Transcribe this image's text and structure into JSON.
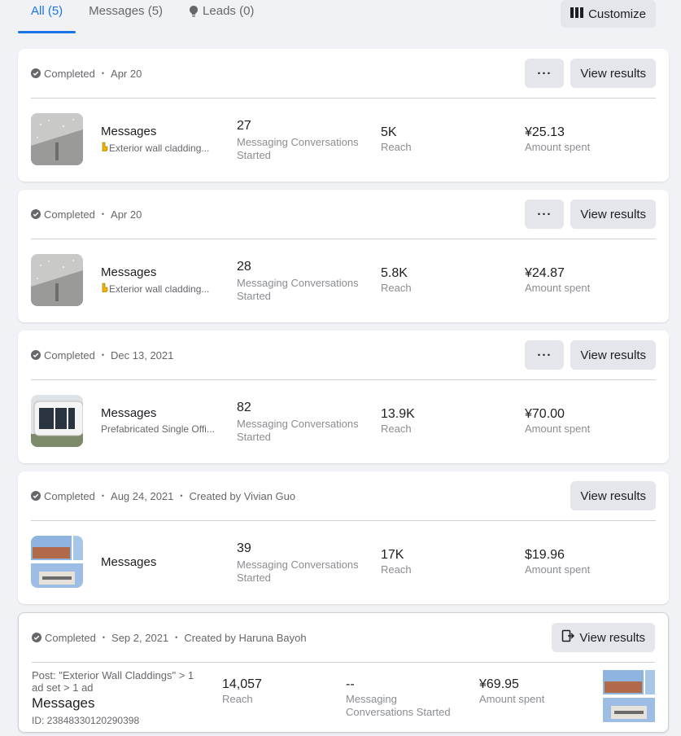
{
  "tabs": [
    {
      "label": "All (5)",
      "active": true
    },
    {
      "label": "Messages (5)",
      "active": false
    },
    {
      "label": "Leads (0)",
      "active": false
    }
  ],
  "customize_label": "Customize",
  "more_label": "···",
  "view_results_label": "View results",
  "cards": [
    {
      "status": "Completed",
      "date": "Apr 20",
      "ad_name": "Messages",
      "ad_sub": "Exterior wall cladding...",
      "m1_val": "27",
      "m1_lbl": "Messaging Conversations Started",
      "m2_val": "5K",
      "m2_lbl": "Reach",
      "m3_val": "¥25.13",
      "m3_lbl": "Amount spent"
    },
    {
      "status": "Completed",
      "date": "Apr 20",
      "ad_name": "Messages",
      "ad_sub": "Exterior wall cladding...",
      "m1_val": "28",
      "m1_lbl": "Messaging Conversations Started",
      "m2_val": "5.8K",
      "m2_lbl": "Reach",
      "m3_val": "¥24.87",
      "m3_lbl": "Amount spent"
    },
    {
      "status": "Completed",
      "date": "Dec 13, 2021",
      "ad_name": "Messages",
      "ad_sub": "Prefabricated Single Offi...",
      "m1_val": "82",
      "m1_lbl": "Messaging Conversations Started",
      "m2_val": "13.9K",
      "m2_lbl": "Reach",
      "m3_val": "¥70.00",
      "m3_lbl": "Amount spent"
    },
    {
      "status": "Completed",
      "date": "Aug 24, 2021",
      "created_by": "Created by Vivian Guo",
      "ad_name": "Messages",
      "m1_val": "39",
      "m1_lbl": "Messaging Conversations Started",
      "m2_val": "17K",
      "m2_lbl": "Reach",
      "m3_val": "$19.96",
      "m3_lbl": "Amount spent"
    }
  ],
  "last_card": {
    "status": "Completed",
    "date": "Sep 2, 2021",
    "created_by": "Created by Haruna Bayoh",
    "post_line": "Post: \"Exterior Wall Claddings\" > 1 ad set > 1 ad",
    "ad_name": "Messages",
    "ad_id": "ID: 23848330120290398",
    "m1_val": "14,057",
    "m1_lbl": "Reach",
    "m2_val": "--",
    "m2_lbl": "Messaging Conversations Started",
    "m3_val": "¥69.95",
    "m3_lbl": "Amount spent"
  },
  "colors": {
    "accent": "#1b74e4",
    "button_bg": "#e4e6eb",
    "page_bg": "#f0f2f5"
  }
}
